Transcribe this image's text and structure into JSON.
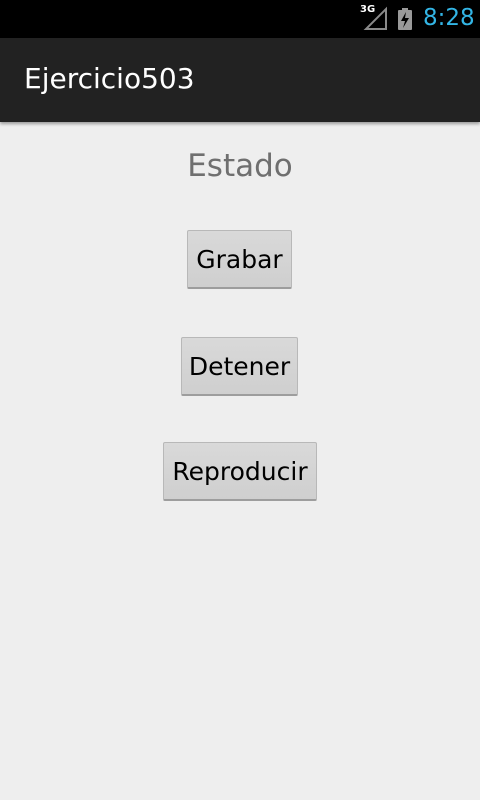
{
  "status_bar": {
    "network_label": "3G",
    "time": "8:28",
    "icons": [
      "signal-icon",
      "battery-charging-icon"
    ],
    "clock_color": "#33b5e5"
  },
  "action_bar": {
    "title": "Ejercicio503"
  },
  "main": {
    "status_text": "Estado",
    "buttons": {
      "record": "Grabar",
      "stop": "Detener",
      "play": "Reproducir"
    }
  }
}
